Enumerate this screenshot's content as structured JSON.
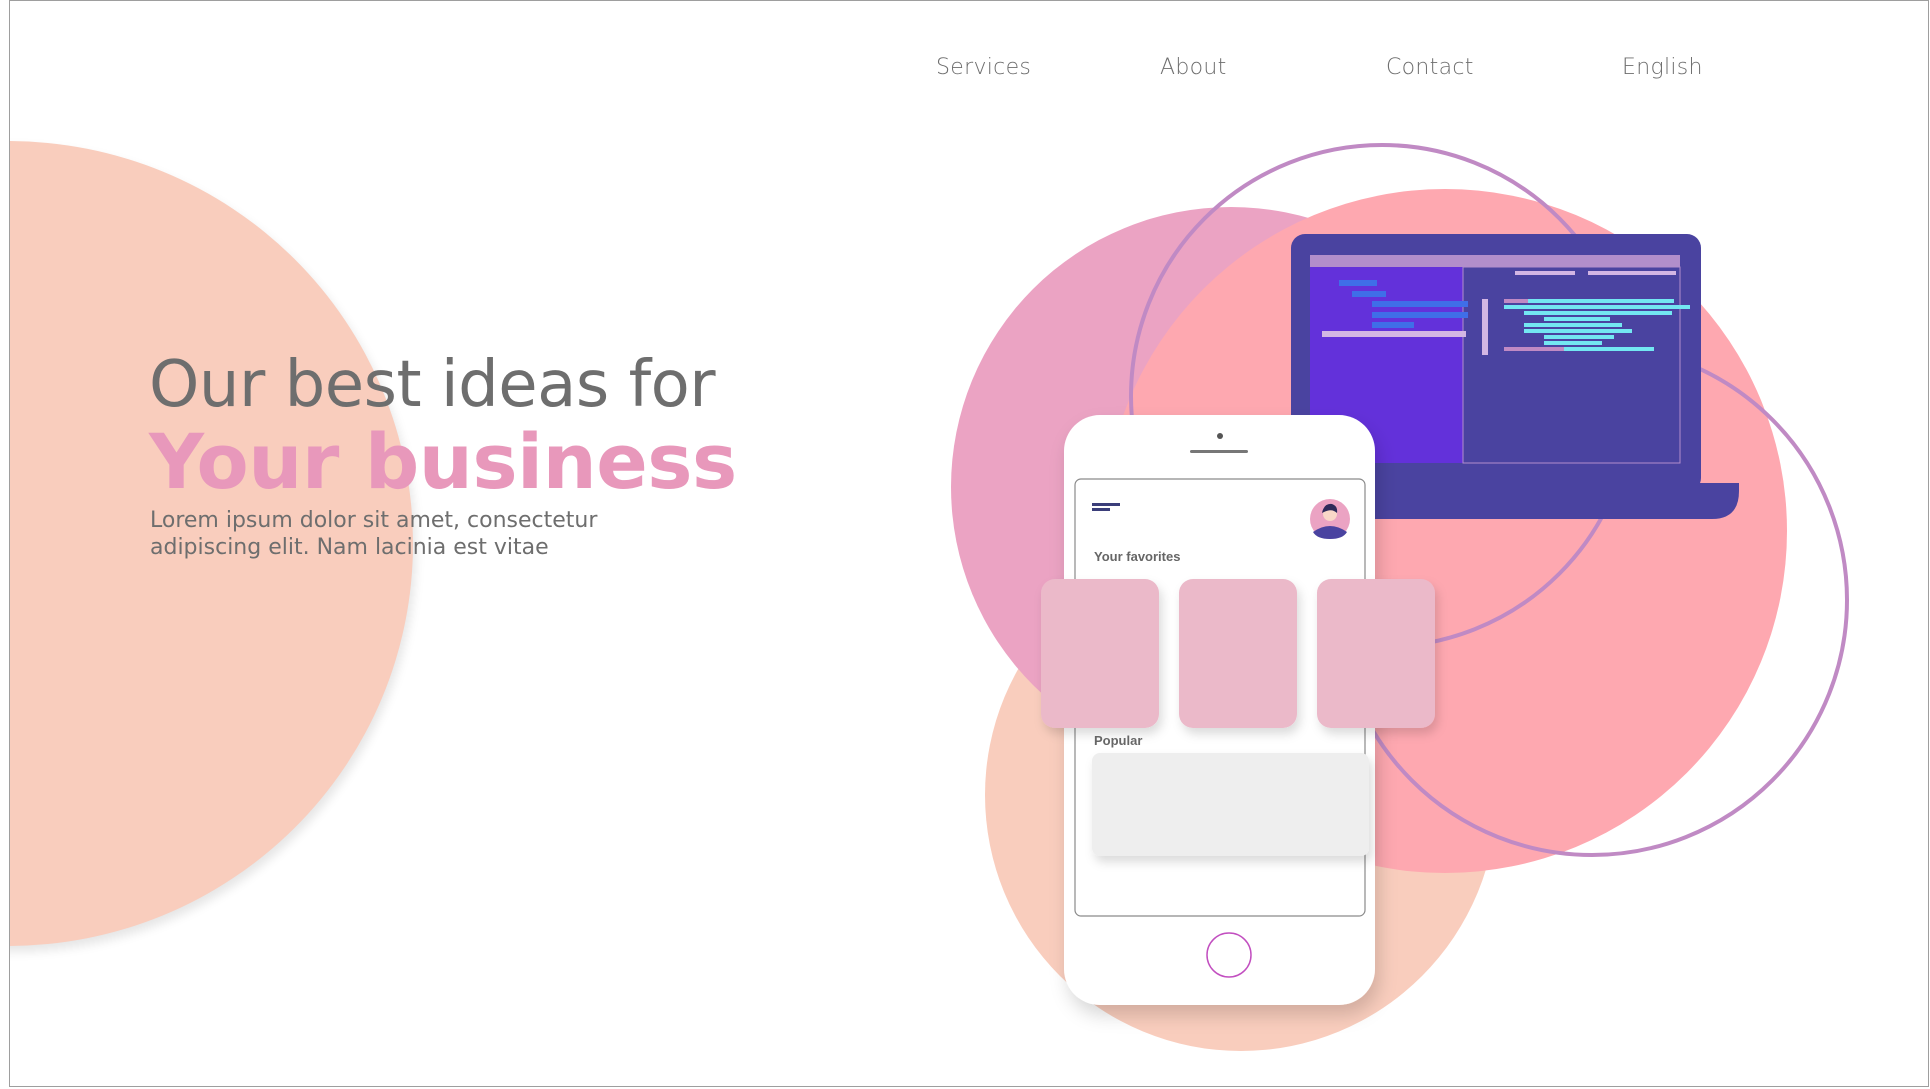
{
  "nav": {
    "items": [
      {
        "label": "Services"
      },
      {
        "label": "About"
      },
      {
        "label": "Contact"
      },
      {
        "label": "English"
      }
    ]
  },
  "hero": {
    "title": "Our best ideas for",
    "subtitle": "Your business",
    "description": "Lorem ipsum dolor sit amet, consectetur adipiscing elit. Nam lacinia est vitae"
  },
  "phone": {
    "favorites_heading": "Your favorites",
    "popular_heading": "Popular"
  },
  "colors": {
    "peach": "#f9cdbd",
    "pink": "#fea8b0",
    "rose": "#eba3c3",
    "accent_pink": "#e898bb",
    "purple_ring": "#c08ac4",
    "laptop_body": "#4a43a0",
    "laptop_screen": "#6331da",
    "code_cyan": "#73e7f2",
    "card": "#ebb9c9",
    "text_gray": "#6e6e6e"
  }
}
